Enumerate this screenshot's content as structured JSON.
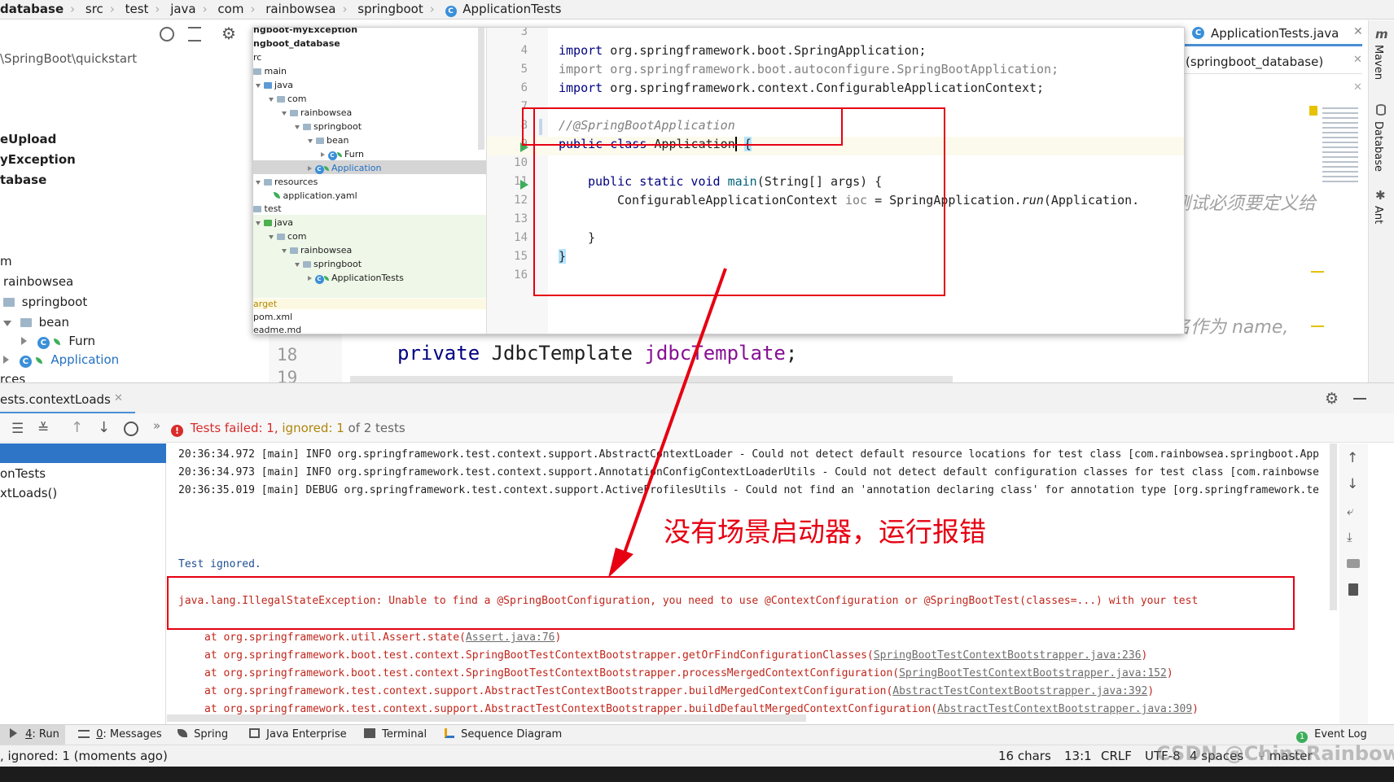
{
  "breadcrumb": [
    "database",
    "src",
    "test",
    "java",
    "com",
    "rainbowsea",
    "springboot",
    "ApplicationTests"
  ],
  "editor_tab": {
    "title": "ApplicationTests.java"
  },
  "right_panel": {
    "row1": "(springboot_database)",
    "hint_cn": "测试必须要定义给",
    "hint2_cn": "名作为 name,"
  },
  "right_strip": {
    "maven": "Maven",
    "database": "Database",
    "ant": "Ant"
  },
  "left_tree": {
    "path": "\\SpringBoot\\quickstart",
    "items": [
      "eUpload",
      "yException",
      "tabase"
    ],
    "pkg": {
      "m": "m",
      "rainbowsea": "rainbowsea",
      "springboot": "springboot",
      "bean": "bean",
      "furn": "Furn",
      "application": "Application",
      "rces": "rces"
    }
  },
  "popup": {
    "tree": {
      "top_label": "ngboot-myException",
      "db_label": "ngboot_database",
      "rc": "rc",
      "main": "main",
      "java": "java",
      "com": "com",
      "rainbowsea": "rainbowsea",
      "springboot": "springboot",
      "bean": "bean",
      "furn": "Furn",
      "application": "Application",
      "resources": "resources",
      "application_yaml": "application.yaml",
      "test": "test",
      "java2": "java",
      "com2": "com",
      "rainbowsea2": "rainbowsea",
      "springboot2": "springboot",
      "application_tests": "ApplicationTests",
      "target": "arget",
      "pom": "pom.xml",
      "readme": "eadme.md"
    },
    "code": {
      "line_numbers": [
        "3",
        "4",
        "5",
        "6",
        "7",
        "8",
        "9",
        "10",
        "11",
        "12",
        "13",
        "14",
        "15",
        "16"
      ],
      "import_kw": "import",
      "import1": "org.springframework.boot.SpringApplication;",
      "import2": "org.springframework.boot.autoconfigure.SpringBootApplication;",
      "import3": "org.springframework.context.ConfigurableApplicationContext;",
      "comment": "//@SpringBootApplication",
      "public_class": "public class",
      "class_name": "Application",
      "brace_open": "{",
      "public_static_void": "public static void",
      "main": "main",
      "main_args": "(String[] args) {",
      "ctx_type": "ConfigurableApplicationContext",
      "ioc": "ioc",
      "eq": "=",
      "spring_app": "SpringApplication.",
      "run": "run",
      "run_args": "(Application.",
      "close_inner": "}",
      "close_outer": "}"
    }
  },
  "bg_editor": {
    "line18": "18",
    "line19": "19",
    "private_kw": "private",
    "jdbc_type": "JdbcTemplate",
    "jdbc_field": "jdbcTemplate",
    "semi": ";"
  },
  "run_panel": {
    "tab": "ests.contextLoads",
    "status_failed": "Tests failed:",
    "failed_count": "1,",
    "ignored_label": "ignored:",
    "ignored_count": "1",
    "of_tests": "of 2 tests",
    "tree_items": [
      "onTests",
      "xtLoads()"
    ],
    "log_lines": [
      "20:36:34.972 [main] INFO org.springframework.test.context.support.AbstractContextLoader - Could not detect default resource locations for test class [com.rainbowsea.springboot.App",
      "20:36:34.973 [main] INFO org.springframework.test.context.support.AnnotationConfigContextLoaderUtils - Could not detect default configuration classes for test class [com.rainbowse",
      "20:36:35.019 [main] DEBUG org.springframework.test.context.support.ActiveProfilesUtils - Could not find an 'annotation declaring class' for annotation type [org.springframework.te"
    ],
    "annotation_cn": "没有场景启动器，运行报错",
    "test_ignored": "Test ignored.",
    "exception": "java.lang.IllegalStateException: Unable to find a @SpringBootConfiguration, you need to use @ContextConfiguration or @SpringBootTest(classes=...) with your test",
    "stack": [
      {
        "prefix": "at org.springframework.util.Assert.state(",
        "link": "Assert.java:76",
        "suffix": ")"
      },
      {
        "prefix": "at org.springframework.boot.test.context.SpringBootTestContextBootstrapper.getOrFindConfigurationClasses(",
        "link": "SpringBootTestContextBootstrapper.java:236",
        "suffix": ")"
      },
      {
        "prefix": "at org.springframework.boot.test.context.SpringBootTestContextBootstrapper.processMergedContextConfiguration(",
        "link": "SpringBootTestContextBootstrapper.java:152",
        "suffix": ")"
      },
      {
        "prefix": "at org.springframework.test.context.support.AbstractTestContextBootstrapper.buildMergedContextConfiguration(",
        "link": "AbstractTestContextBootstrapper.java:392",
        "suffix": ")"
      },
      {
        "prefix": "at org.springframework.test.context.support.AbstractTestContextBootstrapper.buildDefaultMergedContextConfiguration(",
        "link": "AbstractTestContextBootstrapper.java:309",
        "suffix": ")"
      }
    ]
  },
  "bottom_tabs": {
    "run_num": "4",
    "run": ": Run",
    "messages_num": "0",
    "messages": ": Messages",
    "spring": "Spring",
    "java_enterprise": "Java Enterprise",
    "terminal": "Terminal",
    "sequence": "Sequence Diagram",
    "event_log": "Event Log"
  },
  "status_bar": {
    "left": ", ignored: 1 (moments ago)",
    "chars": "16 chars",
    "pos": "13:1",
    "crlf": "CRLF",
    "enc": "UTF-8",
    "indent": "4 spaces",
    "branch": "master",
    "watermark": "CSDN @ChinaRainbowSea"
  },
  "colors": {
    "red": "#e60012",
    "accent": "#2470c2",
    "link": "#6d6d6d",
    "status_red": "#d92b2b"
  }
}
